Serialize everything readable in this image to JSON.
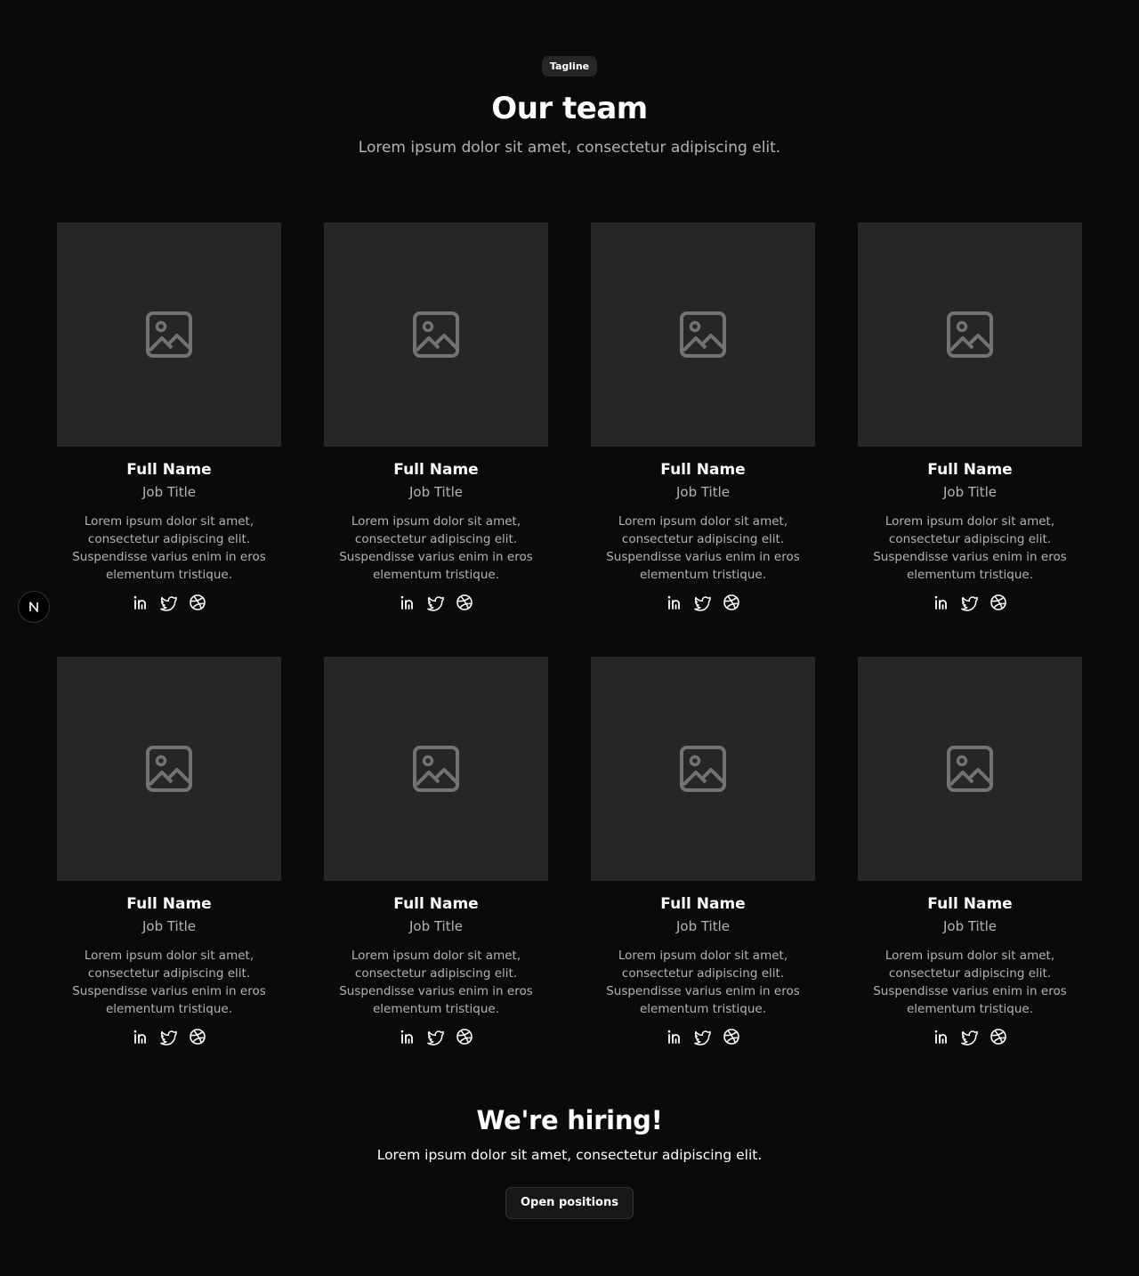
{
  "header": {
    "tagline": "Tagline",
    "title": "Our team",
    "subtitle": "Lorem ipsum dolor sit amet, consectetur adipiscing elit."
  },
  "team": [
    {
      "name": "Full Name",
      "job": "Job Title",
      "bio": "Lorem ipsum dolor sit amet, consectetur adipiscing elit. Suspendisse varius enim in eros elementum tristique."
    },
    {
      "name": "Full Name",
      "job": "Job Title",
      "bio": "Lorem ipsum dolor sit amet, consectetur adipiscing elit. Suspendisse varius enim in eros elementum tristique."
    },
    {
      "name": "Full Name",
      "job": "Job Title",
      "bio": "Lorem ipsum dolor sit amet, consectetur adipiscing elit. Suspendisse varius enim in eros elementum tristique."
    },
    {
      "name": "Full Name",
      "job": "Job Title",
      "bio": "Lorem ipsum dolor sit amet, consectetur adipiscing elit. Suspendisse varius enim in eros elementum tristique."
    },
    {
      "name": "Full Name",
      "job": "Job Title",
      "bio": "Lorem ipsum dolor sit amet, consectetur adipiscing elit. Suspendisse varius enim in eros elementum tristique."
    },
    {
      "name": "Full Name",
      "job": "Job Title",
      "bio": "Lorem ipsum dolor sit amet, consectetur adipiscing elit. Suspendisse varius enim in eros elementum tristique."
    },
    {
      "name": "Full Name",
      "job": "Job Title",
      "bio": "Lorem ipsum dolor sit amet, consectetur adipiscing elit. Suspendisse varius enim in eros elementum tristique."
    },
    {
      "name": "Full Name",
      "job": "Job Title",
      "bio": "Lorem ipsum dolor sit amet, consectetur adipiscing elit. Suspendisse varius enim in eros elementum tristique."
    }
  ],
  "social_icons": [
    "linkedin-icon",
    "twitter-icon",
    "dribbble-icon"
  ],
  "hiring": {
    "title": "We're hiring!",
    "text": "Lorem ipsum dolor sit amet, consectetur adipiscing elit.",
    "button": "Open positions"
  },
  "floating_badge": {
    "icon": "nextjs-logo-icon"
  },
  "colors": {
    "background": "#0a0a0a",
    "card_placeholder": "#262626",
    "placeholder_icon": "#737373",
    "muted_text": "#b3b3b3",
    "button_bg": "#171717",
    "button_border": "#333333"
  }
}
